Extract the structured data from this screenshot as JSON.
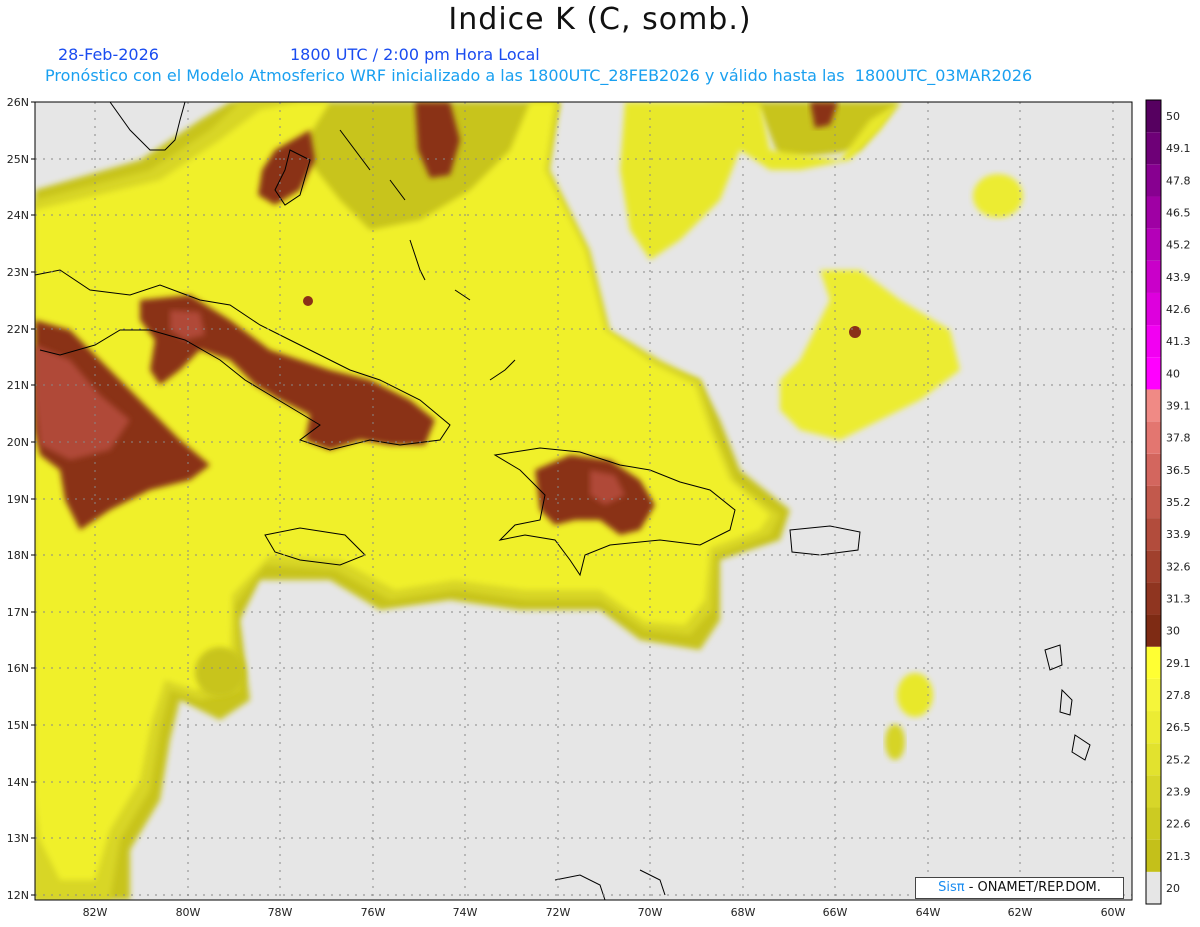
{
  "title": "Indice K (C, somb.)",
  "date": "28-Feb-2026",
  "time_line": "1800 UTC / 2:00 pm Hora Local",
  "description": "Pronóstico con el Modelo Atmosferico WRF inicializado a las 1800UTC_28FEB2026 y válido hasta las  1800UTC_03MAR2026",
  "credit": {
    "brand": "Sisπ",
    "rest": " - ONAMET/REP.DOM."
  },
  "map": {
    "lat_labels": [
      "12N",
      "13N",
      "14N",
      "15N",
      "16N",
      "17N",
      "18N",
      "19N",
      "20N",
      "21N",
      "22N",
      "23N",
      "24N",
      "25N",
      "26N"
    ],
    "lon_labels": [
      "82W",
      "80W",
      "78W",
      "76W",
      "74W",
      "72W",
      "70W",
      "68W",
      "66W",
      "64W",
      "62W",
      "60W"
    ]
  },
  "legend": {
    "labels": [
      "20",
      "21.3",
      "22.6",
      "23.9",
      "25.2",
      "26.5",
      "27.8",
      "29.1",
      "30",
      "31.3",
      "32.6",
      "33.9",
      "35.2",
      "36.5",
      "37.8",
      "39.1",
      "40",
      "41.3",
      "42.6",
      "43.9",
      "45.2",
      "46.5",
      "47.8",
      "49.1",
      "50"
    ],
    "colors": [
      "#e6e6e6",
      "#c4c01a",
      "#cccb22",
      "#d7d629",
      "#e2e22e",
      "#ecec33",
      "#f5f53a",
      "#ffff33",
      "#7e2b14",
      "#8f3520",
      "#a0402d",
      "#b24c3c",
      "#c2594c",
      "#d3665e",
      "#e37670",
      "#f08a85",
      "#ff00ff",
      "#f200f2",
      "#dd00dd",
      "#c900c9",
      "#b400b8",
      "#9f00a4",
      "#870090",
      "#6e0077",
      "#560060"
    ]
  },
  "colors": {
    "ocean": "#e6e6e6",
    "field_yellow": "#f0f02a",
    "field_olive": "#c8c41c",
    "field_brown": "#8a3018",
    "field_salmon": "#c4574a",
    "title_blue": "#1a4cf0",
    "cyan_text": "#1aa0f0"
  }
}
